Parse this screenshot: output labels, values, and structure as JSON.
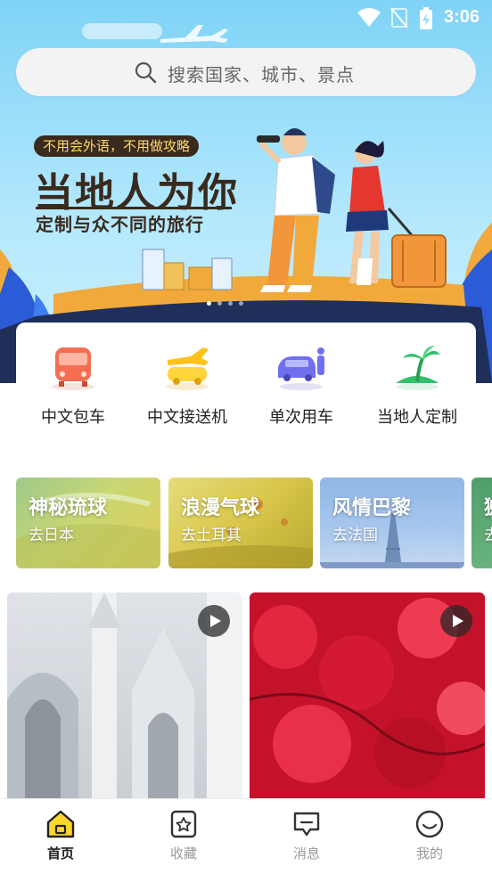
{
  "status_bar": {
    "time": "3:06",
    "icons": [
      "wifi-icon",
      "no-sim-icon",
      "battery-charging-icon"
    ]
  },
  "search": {
    "placeholder": "搜索国家、城市、景点",
    "icon": "search-icon"
  },
  "banner": {
    "tagline": "不用会外语，不用做攻略",
    "title": "当地人为你",
    "subtitle": "定制与众不同的旅行",
    "pagination_active": 1,
    "pagination_count": 4
  },
  "services": [
    {
      "label": "中文包车",
      "icon": "bus-icon"
    },
    {
      "label": "中文接送机",
      "icon": "airport-car-icon"
    },
    {
      "label": "单次用车",
      "icon": "car-driver-icon"
    },
    {
      "label": "当地人定制",
      "icon": "island-palm-icon"
    }
  ],
  "destinations": [
    {
      "title": "神秘琉球",
      "subtitle": "去日本"
    },
    {
      "title": "浪漫气球",
      "subtitle": "去土耳其"
    },
    {
      "title": "风情巴黎",
      "subtitle": "去法国"
    },
    {
      "title": "狮",
      "subtitle": "去"
    }
  ],
  "feed": [
    {
      "type": "video",
      "icon": "play-icon",
      "scene": "church"
    },
    {
      "type": "video",
      "icon": "play-icon",
      "scene": "red-leaves"
    }
  ],
  "bottom_nav": [
    {
      "label": "首页",
      "icon": "home-icon",
      "active": true
    },
    {
      "label": "收藏",
      "icon": "favorites-icon",
      "active": false
    },
    {
      "label": "消息",
      "icon": "messages-icon",
      "active": false
    },
    {
      "label": "我的",
      "icon": "profile-icon",
      "active": false
    }
  ],
  "colors": {
    "accent": "#ffd62a",
    "sky": "#8fdaf8",
    "dark_brown": "#3a2a1e",
    "tagline_text": "#ffd96b"
  }
}
